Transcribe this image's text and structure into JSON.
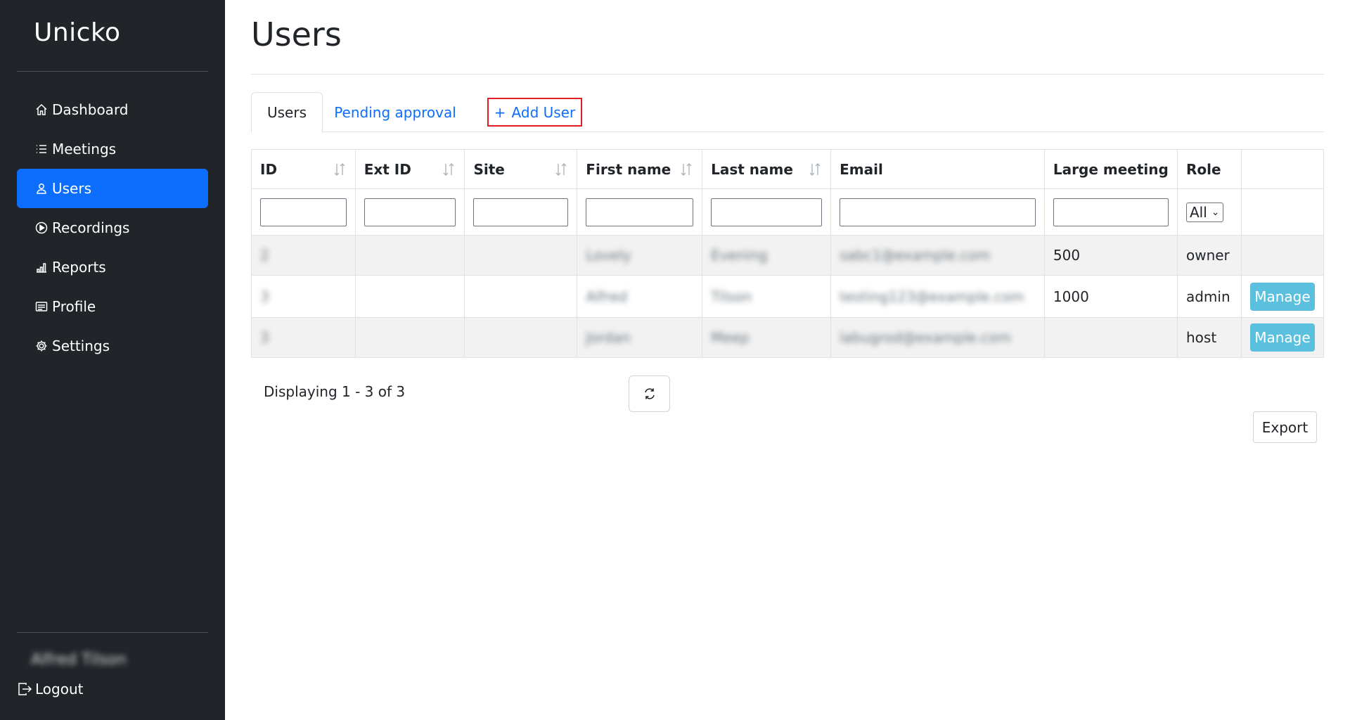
{
  "sidebar": {
    "brand": "Unicko",
    "items": [
      {
        "label": "Dashboard",
        "icon": "house-icon"
      },
      {
        "label": "Meetings",
        "icon": "list-icon"
      },
      {
        "label": "Users",
        "icon": "person-icon",
        "active": true
      },
      {
        "label": "Recordings",
        "icon": "play-circle-icon"
      },
      {
        "label": "Reports",
        "icon": "bar-chart-icon"
      },
      {
        "label": "Profile",
        "icon": "card-text-icon"
      },
      {
        "label": "Settings",
        "icon": "gear-icon"
      }
    ],
    "user_name": "Alfred Tilson",
    "logout_label": "Logout"
  },
  "main": {
    "title": "Users",
    "tabs": [
      {
        "label": "Users",
        "active": true
      },
      {
        "label": "Pending approval"
      },
      {
        "label": "Add User",
        "icon": "plus-icon"
      }
    ],
    "table": {
      "columns": [
        "ID",
        "Ext ID",
        "Site",
        "First name",
        "Last name",
        "Email",
        "Large meeting",
        "Role",
        ""
      ],
      "role_filter": "All",
      "rows": [
        {
          "id": "2",
          "ext_id": "",
          "site": "",
          "first_name": "Lovely",
          "last_name": "Evening",
          "email": "sabc1@example.com",
          "large_meeting": "500",
          "role": "owner",
          "action": ""
        },
        {
          "id": "3",
          "ext_id": "",
          "site": "",
          "first_name": "Alfred",
          "last_name": "Tilson",
          "email": "testing123@example.com",
          "large_meeting": "1000",
          "role": "admin",
          "action": "Manage"
        },
        {
          "id": "3",
          "ext_id": "",
          "site": "",
          "first_name": "Jordan",
          "last_name": "Meep",
          "email": "labugrod@example.com",
          "large_meeting": "",
          "role": "host",
          "action": "Manage"
        }
      ]
    },
    "pagination_text": "Displaying 1 - 3 of 3",
    "export_label": "Export"
  },
  "colors": {
    "sidebar_bg": "#212529",
    "active_nav": "#0d6efd",
    "link": "#0d6efd",
    "manage_button": "#5bc0de",
    "highlight_border": "#e31b23"
  }
}
